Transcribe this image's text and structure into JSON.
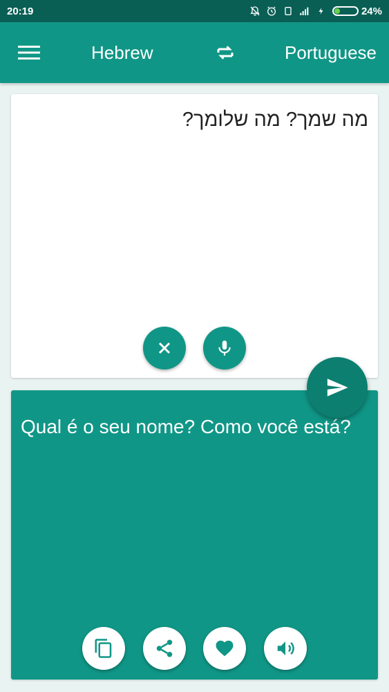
{
  "status_bar": {
    "time": "20:19",
    "battery_percent": "24%",
    "battery_level": 0.24
  },
  "app_bar": {
    "source_language": "Hebrew",
    "target_language": "Portuguese"
  },
  "input": {
    "text": "מה שמך? מה שלומך?"
  },
  "output": {
    "text": "Qual é o seu nome? Como você está?"
  },
  "icons": {
    "menu": "menu-icon",
    "swap": "swap-icon",
    "clear": "close-icon",
    "mic": "mic-icon",
    "send": "send-icon",
    "copy": "copy-icon",
    "share": "share-icon",
    "favorite": "heart-icon",
    "speak": "speaker-icon"
  },
  "colors": {
    "primary": "#109686",
    "primary_dark": "#0d7f71",
    "status_bar": "#0a5f55",
    "background": "#e9f3f1"
  }
}
